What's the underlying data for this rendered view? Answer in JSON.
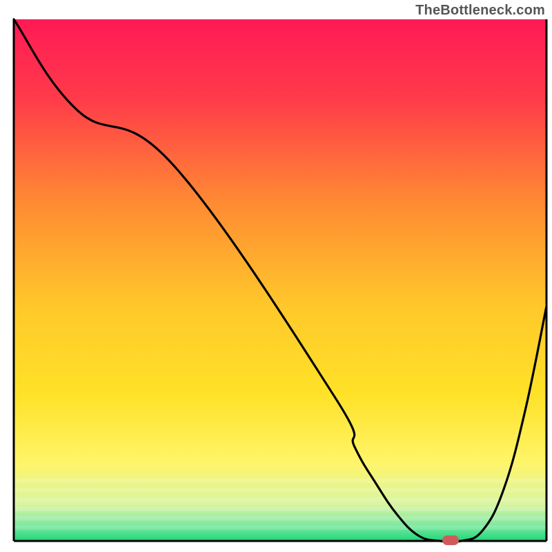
{
  "watermark": "TheBottleneck.com",
  "chart_data": {
    "type": "line",
    "title": "",
    "xlabel": "",
    "ylabel": "",
    "xlim": [
      0,
      100
    ],
    "ylim": [
      0,
      100
    ],
    "grid": false,
    "legend": false,
    "series": [
      {
        "name": "bottleneck-curve",
        "x": [
          0,
          12,
          30,
          60,
          64,
          68,
          72,
          76,
          80,
          84,
          88,
          92,
          96,
          100
        ],
        "values": [
          100,
          82.5,
          72,
          28,
          18,
          11,
          5,
          1,
          0,
          0,
          2,
          10,
          25,
          45
        ]
      }
    ],
    "marker": {
      "name": "current-config",
      "x": 82,
      "y": 0,
      "color": "#d05a5a"
    },
    "background_gradient": {
      "stops": [
        {
          "offset": 0.0,
          "color": "#ff1a55"
        },
        {
          "offset": 0.15,
          "color": "#ff3a4a"
        },
        {
          "offset": 0.35,
          "color": "#ff8a33"
        },
        {
          "offset": 0.55,
          "color": "#ffc82a"
        },
        {
          "offset": 0.72,
          "color": "#ffe228"
        },
        {
          "offset": 0.85,
          "color": "#fff56a"
        },
        {
          "offset": 0.93,
          "color": "#d8f5a0"
        },
        {
          "offset": 0.97,
          "color": "#7de8a0"
        },
        {
          "offset": 1.0,
          "color": "#1fd67a"
        }
      ]
    }
  }
}
